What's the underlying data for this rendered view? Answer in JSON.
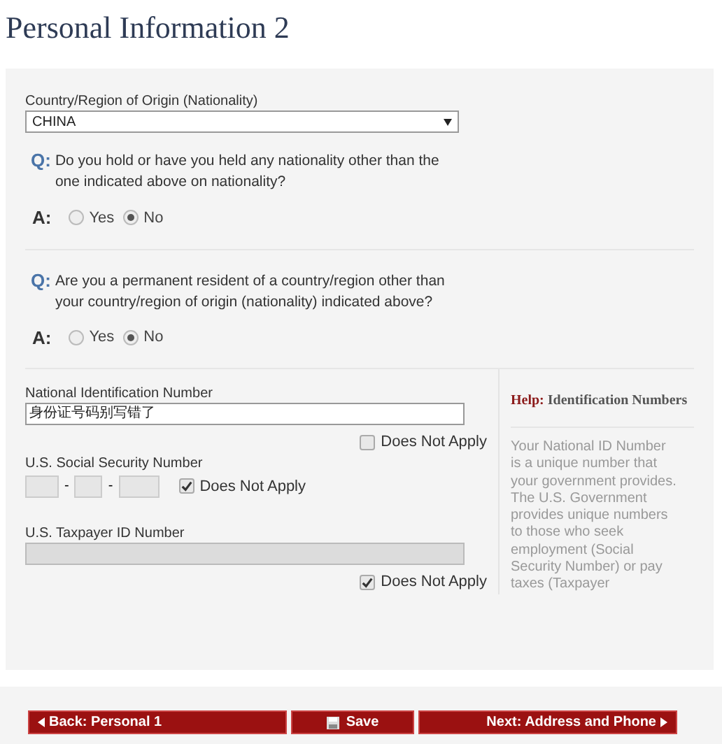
{
  "title": "Personal Information 2",
  "nationality": {
    "label": "Country/Region of Origin (Nationality)",
    "value": "CHINA"
  },
  "questions": [
    {
      "q_mark": "Q:",
      "text": "Do you hold or have you held any nationality other than the one indicated above on nationality?",
      "a_mark": "A:",
      "options": [
        {
          "label": "Yes",
          "selected": false
        },
        {
          "label": "No",
          "selected": true
        }
      ]
    },
    {
      "q_mark": "Q:",
      "text": "Are you a permanent resident of a country/region other than your country/region of origin (nationality) indicated above?",
      "a_mark": "A:",
      "options": [
        {
          "label": "Yes",
          "selected": false
        },
        {
          "label": "No",
          "selected": true
        }
      ]
    }
  ],
  "national_id": {
    "label": "National Identification Number",
    "value": "身份证号码别写错了",
    "does_not_apply": {
      "label": "Does Not Apply",
      "checked": false
    }
  },
  "ssn": {
    "label": "U.S. Social Security Number",
    "separator": "-",
    "does_not_apply": {
      "label": "Does Not Apply",
      "checked": true
    }
  },
  "taxpayer_id": {
    "label": "U.S. Taxpayer ID Number",
    "does_not_apply": {
      "label": "Does Not Apply",
      "checked": true
    }
  },
  "help": {
    "prefix": "Help:",
    "title": "Identification Numbers",
    "text": "Your National ID Number is a unique number that your government provides. The U.S. Government provides unique numbers to those who seek employment (Social Security Number) or pay taxes (Taxpayer"
  },
  "buttons": {
    "back": "Back: Personal 1",
    "save": "Save",
    "next": "Next: Address and Phone"
  }
}
